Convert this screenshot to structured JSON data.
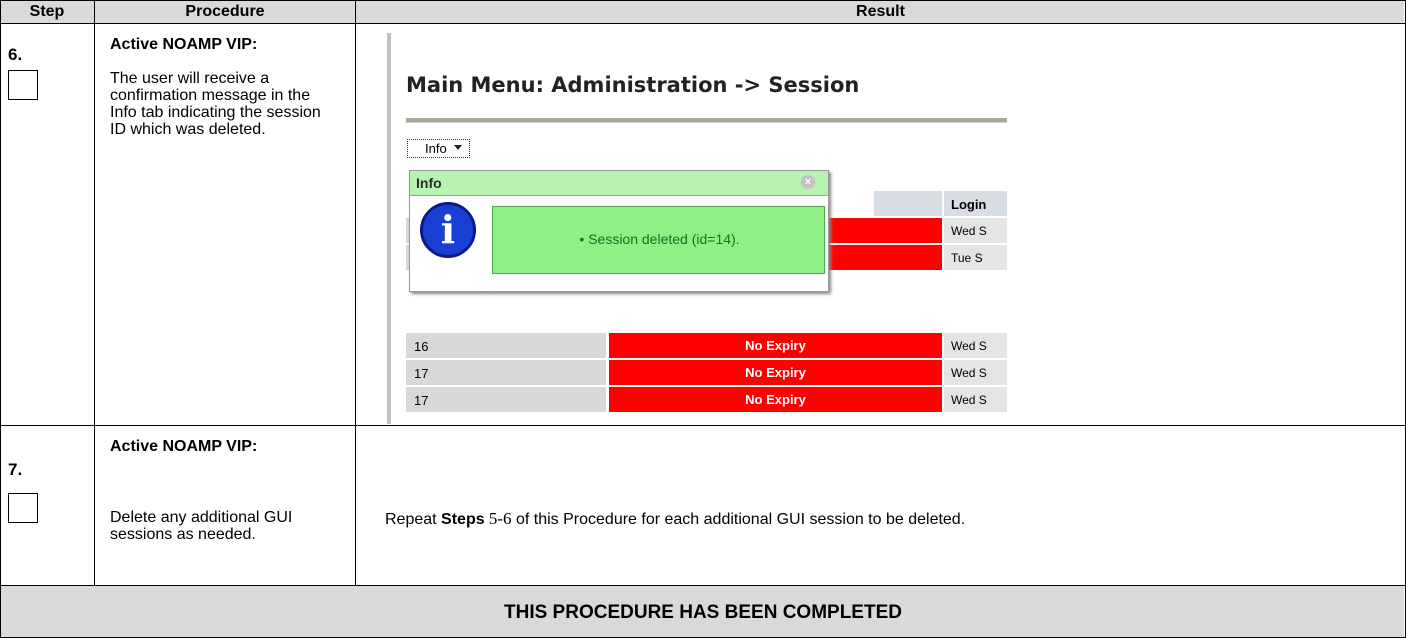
{
  "header": {
    "step": "Step",
    "procedure": "Procedure",
    "result": "Result"
  },
  "steps": [
    {
      "number": "6.",
      "title": "Active NOAMP VIP:",
      "text": "The user will receive a confirmation message in the Info tab indicating the session ID which was deleted."
    },
    {
      "number": "7.",
      "title": "Active NOAMP VIP:",
      "text": "Delete any additional GUI sessions as needed.",
      "result_prefix": "Repeat ",
      "result_bold": "Steps",
      "result_steps": " 5-6",
      "result_suffix": " of this Procedure for each additional GUI session to be deleted."
    }
  ],
  "screenshot": {
    "title": "Main Menu: Administration -> Session",
    "info_button": "Info",
    "popup_title": "Info",
    "popup_message": "• Session deleted (id=14).",
    "column_login": "Login",
    "rows": [
      {
        "id": "",
        "expiry": "",
        "login": "Wed S"
      },
      {
        "id": "",
        "expiry": "",
        "login": "Tue S"
      },
      {
        "id": "16",
        "expiry": "No Expiry",
        "login": "Wed S"
      },
      {
        "id": "17",
        "expiry": "No Expiry",
        "login": "Wed S"
      },
      {
        "id": "17",
        "expiry": "No Expiry",
        "login": "Wed S"
      }
    ],
    "colors": {
      "popup_header": "#b7f2b0",
      "message_bg": "#8ff088",
      "expiry_red": "#ff0000",
      "info_icon_blue": "#1a3fd4"
    },
    "icons": [
      "info-icon",
      "close-icon",
      "chevron-down-icon"
    ]
  },
  "footer": "THIS PROCEDURE HAS BEEN COMPLETED"
}
